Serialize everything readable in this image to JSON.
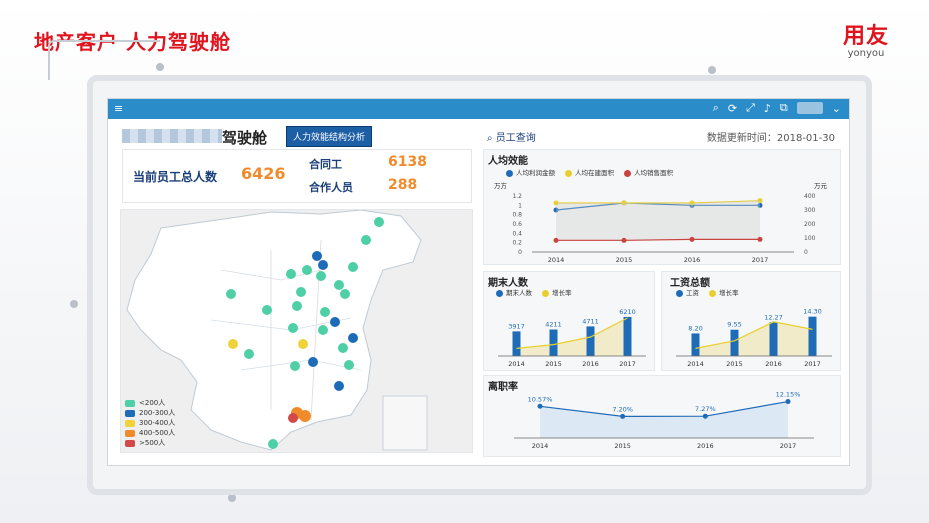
{
  "slide": {
    "title": "地产客户 人力驾驶舱"
  },
  "logo": {
    "cn": "用友",
    "en": "yonyou"
  },
  "topbar": {
    "menu_icon": "≡",
    "icons": [
      "search-icon",
      "refresh-icon",
      "expand-icon",
      "bell-icon",
      "export-icon"
    ]
  },
  "header": {
    "cockpit_title": "驾驶舱",
    "analysis_button": "人力效能结构分析"
  },
  "stats": {
    "total_label": "当前员工总人数",
    "total_value": "6426",
    "contract_label": "合同工",
    "contract_value": "6138",
    "partner_label": "合作人员",
    "partner_value": "288"
  },
  "map": {
    "legend": [
      {
        "label": "<200人",
        "color": "#4ecfa6"
      },
      {
        "label": "200-300人",
        "color": "#1e6bb8"
      },
      {
        "label": "300-400人",
        "color": "#f0d23a"
      },
      {
        "label": "400-500人",
        "color": "#f08b2c"
      },
      {
        "label": ">500人",
        "color": "#d04a4a"
      }
    ]
  },
  "right": {
    "query_label": "员工查询",
    "update_text": "数据更新时间：2018-01-30"
  },
  "colors": {
    "blue": "#1e6bb8",
    "yellow": "#e9cf2e",
    "red": "#c9443f",
    "accent": "#2a8cc9"
  },
  "chart_data": [
    {
      "type": "line",
      "title": "人均效能",
      "x": [
        "2014",
        "2015",
        "2016",
        "2017"
      ],
      "ylabel_left": "万方",
      "ylabel_right": "万元",
      "ylim_left": [
        0,
        1.2
      ],
      "ylim_right": [
        0,
        400
      ],
      "yticks_left": [
        "1.2",
        "1",
        "0.8",
        "0.6",
        "0.4",
        "0.2",
        "0"
      ],
      "yticks_right": [
        "400",
        "300",
        "200",
        "100",
        "0"
      ],
      "series": [
        {
          "name": "人均利润金额",
          "axis": "left",
          "values": [
            0.9,
            1.05,
            1.0,
            1.0
          ]
        },
        {
          "name": "人均在建面积",
          "axis": "left",
          "values": [
            1.05,
            1.05,
            1.05,
            1.1
          ]
        },
        {
          "name": "人均销售面积",
          "axis": "left",
          "values": [
            0.25,
            0.25,
            0.27,
            0.27
          ]
        }
      ]
    },
    {
      "type": "bar",
      "title": "期末人数",
      "categories": [
        "2014",
        "2015",
        "2016",
        "2017"
      ],
      "series": [
        {
          "name": "期末人数",
          "values": [
            3917,
            4211,
            4711,
            6210
          ]
        },
        {
          "name": "增长率",
          "values": [
            0.2,
            0.3,
            0.5,
            1.0
          ]
        }
      ],
      "labels": [
        "3917",
        "4211",
        "4711",
        "6210"
      ],
      "ylim": [
        0,
        7000
      ]
    },
    {
      "type": "bar",
      "title": "工资总额",
      "categories": [
        "2014",
        "2015",
        "2016",
        "2017"
      ],
      "series": [
        {
          "name": "工资",
          "values": [
            8.2,
            9.55,
            12.27,
            14.3
          ]
        },
        {
          "name": "增长率",
          "values": [
            0.2,
            0.4,
            0.9,
            0.7
          ]
        }
      ],
      "labels": [
        "8.20",
        "9.55",
        "12.27",
        "14.30"
      ],
      "ylim": [
        0,
        16
      ]
    },
    {
      "type": "line",
      "title": "离职率",
      "x": [
        "2014",
        "2015",
        "2016",
        "2017"
      ],
      "series": [
        {
          "name": "离职率",
          "values": [
            10.57,
            7.2,
            7.27,
            12.15
          ]
        }
      ],
      "labels": [
        "10.57%",
        "7.20%",
        "7.27%",
        "12.15%"
      ],
      "ylim": [
        0,
        14
      ]
    }
  ]
}
